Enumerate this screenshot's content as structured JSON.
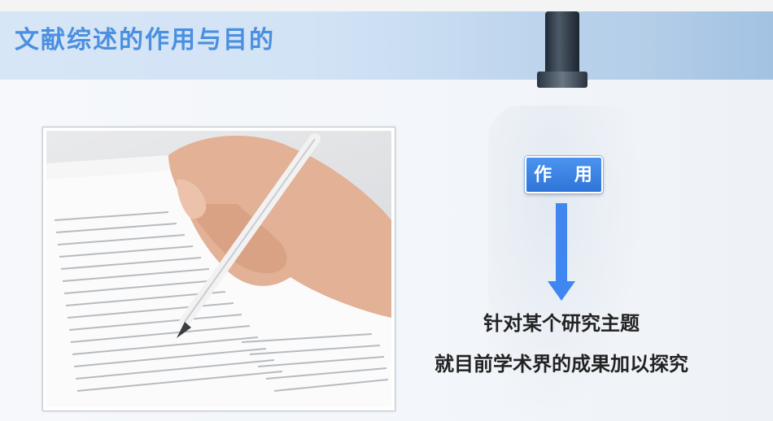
{
  "slide": {
    "title": "文献综述的作用与目的",
    "badge_label": "作 用",
    "description_line1": "针对某个研究主题",
    "description_line2": "就目前学术界的成果加以探究"
  },
  "icons": {
    "arrow": "arrow-down-icon",
    "photo": "hand-writing-on-paper-image",
    "background": "microscope-background"
  },
  "colors": {
    "title": "#4a8fe0",
    "badge": "#3a80e4",
    "arrow": "#3f86f0",
    "text": "#222222"
  }
}
